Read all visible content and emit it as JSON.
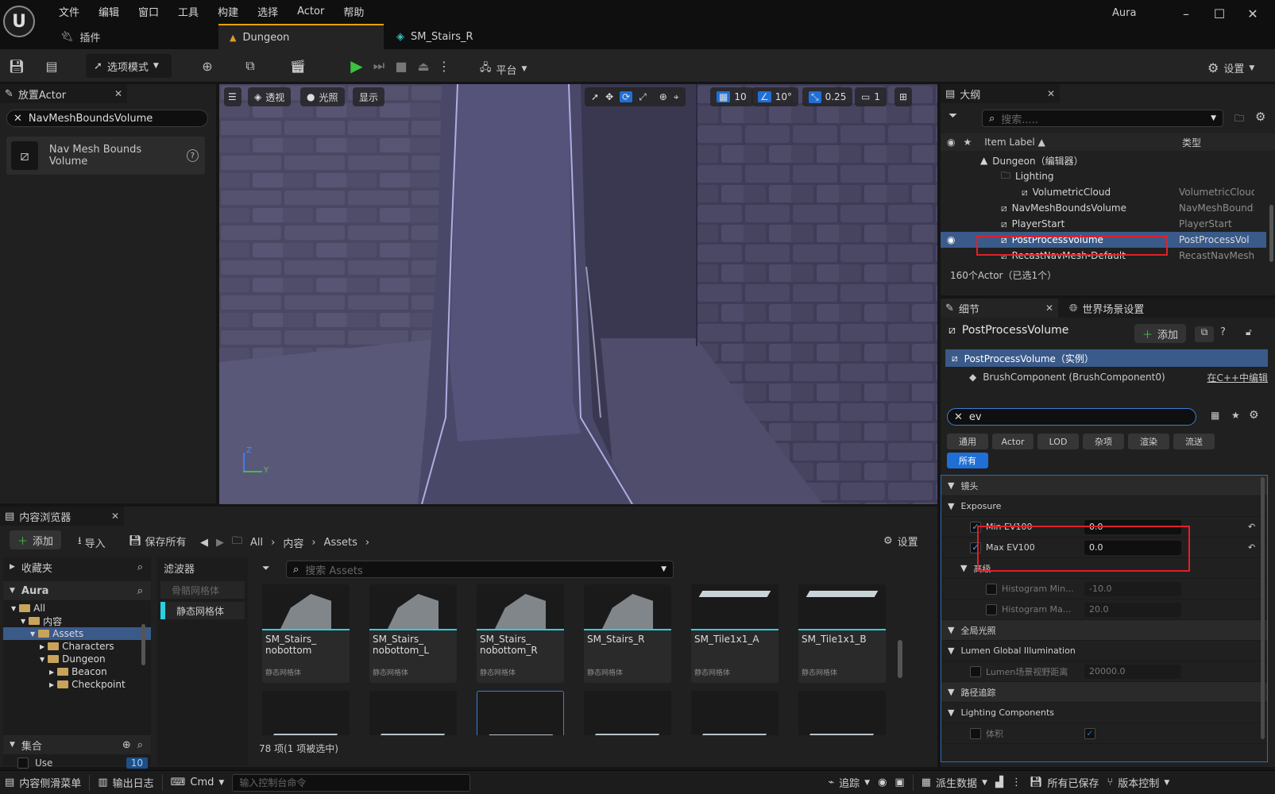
{
  "title_bar": {
    "menu": [
      "文件",
      "编辑",
      "窗口",
      "工具",
      "构建",
      "选择",
      "Actor",
      "帮助"
    ],
    "project": "Aura",
    "plugins_tab": "插件",
    "tabs": [
      {
        "label": "Dungeon",
        "active": true
      },
      {
        "label": "SM_Stairs_R",
        "active": false
      }
    ]
  },
  "toolbar": {
    "mode_label": "选项模式",
    "platform_label": "平台",
    "settings_label": "设置"
  },
  "place_actor": {
    "title": "放置Actor",
    "search_value": "NavMeshBoundsVolume",
    "result_label": "Nav Mesh Bounds Volume"
  },
  "viewport": {
    "perspective": "透视",
    "lit": "光照",
    "show": "显示",
    "grid_value": "10",
    "angle_value": "10°",
    "scale_value": "0.25",
    "camera_speed": "1",
    "axis_z": "Z",
    "axis_y": "Y"
  },
  "outliner": {
    "title": "大纲",
    "search_placeholder": "搜索.....",
    "col_label": "Item Label ▲",
    "col_type": "类型",
    "rows": [
      {
        "label": "Dungeon（编辑器）",
        "type": "",
        "indent": 1
      },
      {
        "label": "Lighting",
        "type": "",
        "indent": 2
      },
      {
        "label": "VolumetricCloud",
        "type": "VolumetricCloud",
        "indent": 3
      },
      {
        "label": "NavMeshBoundsVolume",
        "type": "NavMeshBound:",
        "indent": 2
      },
      {
        "label": "PlayerStart",
        "type": "PlayerStart",
        "indent": 2
      },
      {
        "label": "PostProcessVolume",
        "type": "PostProcessVol",
        "indent": 2,
        "selected": true
      },
      {
        "label": "RecastNavMesh-Default",
        "type": "RecastNavMesh",
        "indent": 2
      }
    ],
    "count_label": "160个Actor（已选1个）"
  },
  "details": {
    "title": "细节",
    "world_settings_tab": "世界场景设置",
    "object_name": "PostProcessVolume",
    "add_label": "添加",
    "instance_label": "PostProcessVolume（实例）",
    "component_label": "BrushComponent (BrushComponent0)",
    "edit_cpp": "在C++中编辑",
    "search_value": "ev",
    "filters": [
      "通用",
      "Actor",
      "LOD",
      "杂项",
      "渲染",
      "流送"
    ],
    "filter_all": "所有",
    "sections": {
      "lens": "镜头",
      "exposure": "Exposure",
      "min_ev": "Min EV100",
      "min_ev_val": "0.0",
      "max_ev": "Max EV100",
      "max_ev_val": "0.0",
      "advanced": "高级",
      "hist_min": "Histogram Min...",
      "hist_min_val": "-10.0",
      "hist_max": "Histogram Ma...",
      "hist_max_val": "20.0",
      "gi": "全局光照",
      "lumen_gi": "Lumen Global Illumination",
      "lumen_scene": "Lumen场景视野距离",
      "lumen_scene_val": "20000.0",
      "path_tracing": "路径追踪",
      "lighting_components": "Lighting Components",
      "volume": "体积"
    }
  },
  "content_browser": {
    "title": "内容浏览器",
    "add_label": "添加",
    "import_label": "导入",
    "save_all_label": "保存所有",
    "breadcrumb": [
      "All",
      "内容",
      "Assets"
    ],
    "settings_label": "设置",
    "favorites": "收藏夹",
    "project_root": "Aura",
    "tree": [
      {
        "label": "All",
        "indent": 0
      },
      {
        "label": "内容",
        "indent": 1
      },
      {
        "label": "Assets",
        "indent": 2,
        "selected": true
      },
      {
        "label": "Characters",
        "indent": 3
      },
      {
        "label": "Dungeon",
        "indent": 3
      },
      {
        "label": "Beacon",
        "indent": 4
      },
      {
        "label": "Checkpoint",
        "indent": 4
      }
    ],
    "collections": "集合",
    "collection_item": "Use",
    "collection_count": "10",
    "filters_title": "滤波器",
    "filter_items": [
      "骨骼网格体",
      "静态网格体"
    ],
    "search_placeholder": "搜索 Assets",
    "assets": [
      {
        "name": "SM_Stairs_\nnobottom",
        "type": "静态网格体"
      },
      {
        "name": "SM_Stairs_\nnobottom_L",
        "type": "静态网格体"
      },
      {
        "name": "SM_Stairs_\nnobottom_R",
        "type": "静态网格体"
      },
      {
        "name": "SM_Stairs_R",
        "type": "静态网格体"
      },
      {
        "name": "SM_Tile1x1_A",
        "type": "静态网格体"
      },
      {
        "name": "SM_Tile1x1_B",
        "type": "静态网格体"
      }
    ],
    "item_count": "78 项(1 项被选中)"
  },
  "status_bar": {
    "drawer": "内容侧滑菜单",
    "output_log": "输出日志",
    "cmd": "Cmd",
    "console_placeholder": "输入控制台命令",
    "trace": "追踪",
    "derived_data": "派生数据",
    "all_saved": "所有已保存",
    "source_control": "版本控制"
  }
}
